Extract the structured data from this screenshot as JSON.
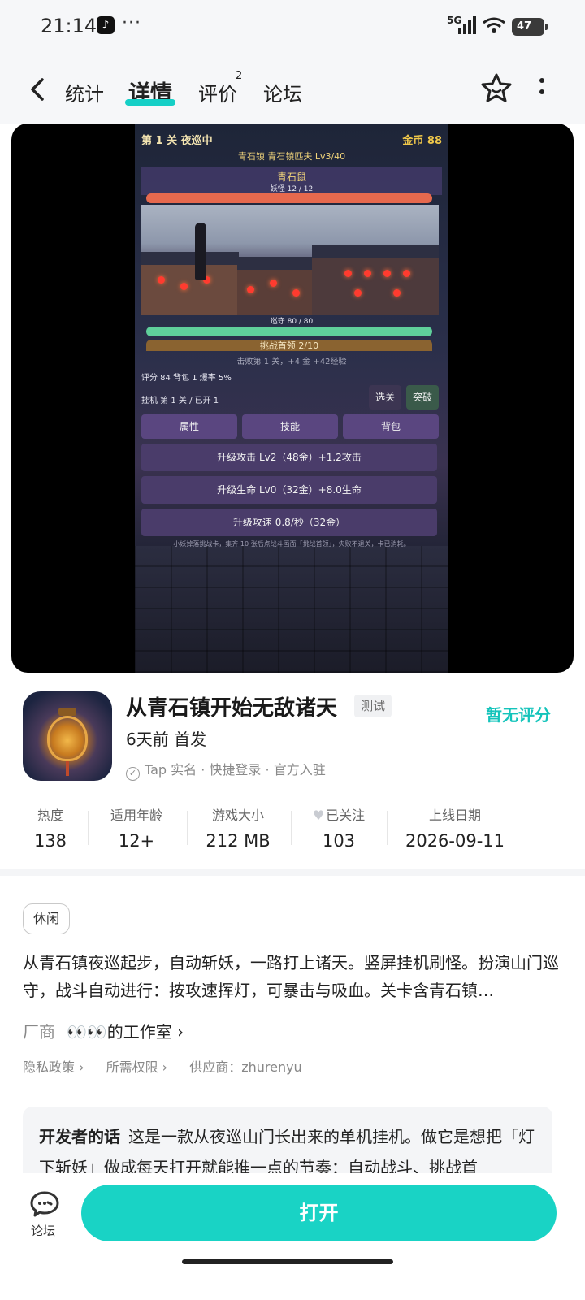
{
  "status_bar": {
    "time": "21:14",
    "notification_icon": "tiktok-icon",
    "more": "···",
    "network": "5G",
    "battery": "47"
  },
  "nav": {
    "tabs": [
      {
        "label": "统计"
      },
      {
        "label": "详情",
        "active": true
      },
      {
        "label": "评价",
        "badge": "2"
      },
      {
        "label": "论坛"
      }
    ]
  },
  "game_screenshot": {
    "level": "第 1 关  夜巡中",
    "gold": "金币 88",
    "location": "青石镇  青石镇匹夫  Lv3/40",
    "enemy_name": "青石鼠",
    "enemy_hp": "妖怪  12 / 12",
    "guard_hp": "巡守  80 / 80",
    "challenge": "挑战首领  2/10",
    "kill_reward": "击败第 1 关，+4 金  +42经验",
    "stats_line": "评分 84  背包 1  爆率 5%",
    "idle_line": "挂机 第 1 关 / 已开 1",
    "btn_select": "选关",
    "btn_breakthrough": "突破",
    "tab_attr": "属性",
    "tab_skill": "技能",
    "tab_bag": "背包",
    "upgrade_attack": "升级攻击  Lv2（48金）+1.2攻击",
    "upgrade_hp": "升级生命  Lv0（32金）+8.0生命",
    "upgrade_speed": "升级攻速  0.8/秒（32金）",
    "tip": "小妖掉落挑战卡，集齐 10 张后点战斗画面「挑战首领」，失败不退关，卡已消耗。"
  },
  "app": {
    "title": "从青石镇开始无敌诸天",
    "badge": "测试",
    "release": "6天前 首发",
    "verify": "Tap 实名 · 快捷登录 · 官方入驻",
    "rating": "暂无评分"
  },
  "stats": [
    {
      "label": "热度",
      "value": "138"
    },
    {
      "label": "适用年龄",
      "value": "12+"
    },
    {
      "label": "游戏大小",
      "value": "212 MB"
    },
    {
      "label": "已关注",
      "value": "103"
    },
    {
      "label": "上线日期",
      "value": "2026-09-11"
    }
  ],
  "details": {
    "tag": "休闲",
    "description": "从青石镇夜巡起步，自动斩妖，一路打上诸天。竖屏挂机刷怪。扮演山门巡守，战斗自动进行：按攻速挥灯，可暴击与吸血。关卡含青石镇…",
    "vendor_label": "厂商",
    "vendor_name": "👀👀的工作室 ›",
    "privacy": "隐私政策 ›",
    "permissions": "所需权限 ›",
    "supplier": "供应商：zhurenyu"
  },
  "developer_note": {
    "title": "开发者的话",
    "text": "这是一款从夜巡山门长出来的单机挂机。做它是想把「灯下斩妖」做成每天打开就能推一点的节奏：自动战斗、挑战首"
  },
  "bottom": {
    "forum_label": "论坛",
    "open_label": "打开"
  },
  "colors": {
    "accent": "#19d3c5",
    "rating": "#14c4bb"
  }
}
